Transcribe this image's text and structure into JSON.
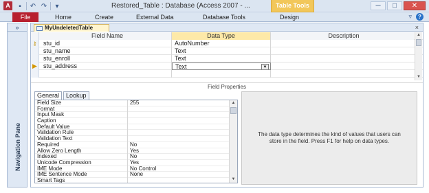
{
  "window": {
    "title": "Restored_Table : Database (Access 2007 - ...",
    "app_icon": "A",
    "contextual_tab": "Table Tools",
    "qat_icons": [
      "save-icon",
      "undo-icon",
      "redo-icon",
      "customize-qat-icon"
    ],
    "buttons": {
      "minimize": "─",
      "restore": "□",
      "close": "✕"
    }
  },
  "ribbon": {
    "file": "File",
    "tabs": [
      "Home",
      "Create",
      "External Data",
      "Database Tools",
      "Design"
    ],
    "collapse": "▿",
    "help": "?"
  },
  "nav_pane": {
    "toggle": "»",
    "label": "Navigation Pane"
  },
  "document": {
    "tab_title": "MyUndeletedTable",
    "close": "×"
  },
  "grid": {
    "headers": {
      "field_name": "Field Name",
      "data_type": "Data Type",
      "description": "Description"
    },
    "rows": [
      {
        "name": "stu_id",
        "type": "AutoNumber",
        "desc": "",
        "primary_key": true
      },
      {
        "name": "stu_name",
        "type": "Text",
        "desc": ""
      },
      {
        "name": "stu_enroll",
        "type": "Text",
        "desc": ""
      },
      {
        "name": "stu_address",
        "type": "Text",
        "desc": "",
        "selected": true
      },
      {
        "name": "",
        "type": "",
        "desc": ""
      }
    ]
  },
  "field_properties": {
    "label": "Field Properties",
    "tabs": [
      "General",
      "Lookup"
    ],
    "active_tab": "General",
    "properties": [
      {
        "name": "Field Size",
        "value": "255"
      },
      {
        "name": "Format",
        "value": ""
      },
      {
        "name": "Input Mask",
        "value": ""
      },
      {
        "name": "Caption",
        "value": ""
      },
      {
        "name": "Default Value",
        "value": ""
      },
      {
        "name": "Validation Rule",
        "value": ""
      },
      {
        "name": "Validation Text",
        "value": ""
      },
      {
        "name": "Required",
        "value": "No"
      },
      {
        "name": "Allow Zero Length",
        "value": "Yes"
      },
      {
        "name": "Indexed",
        "value": "No"
      },
      {
        "name": "Unicode Compression",
        "value": "Yes"
      },
      {
        "name": "IME Mode",
        "value": "No Control"
      },
      {
        "name": "IME Sentence Mode",
        "value": "None"
      },
      {
        "name": "Smart Tags",
        "value": ""
      }
    ],
    "help_text": "The data type determines the kind of values that users can store in the field. Press F1 for help on data types."
  },
  "colors": {
    "file_tab": "#b8202f",
    "contextual_tab": "#f2c75a",
    "selected_column": "#fde9a8",
    "ribbon_bg": "#dbe5f1"
  }
}
